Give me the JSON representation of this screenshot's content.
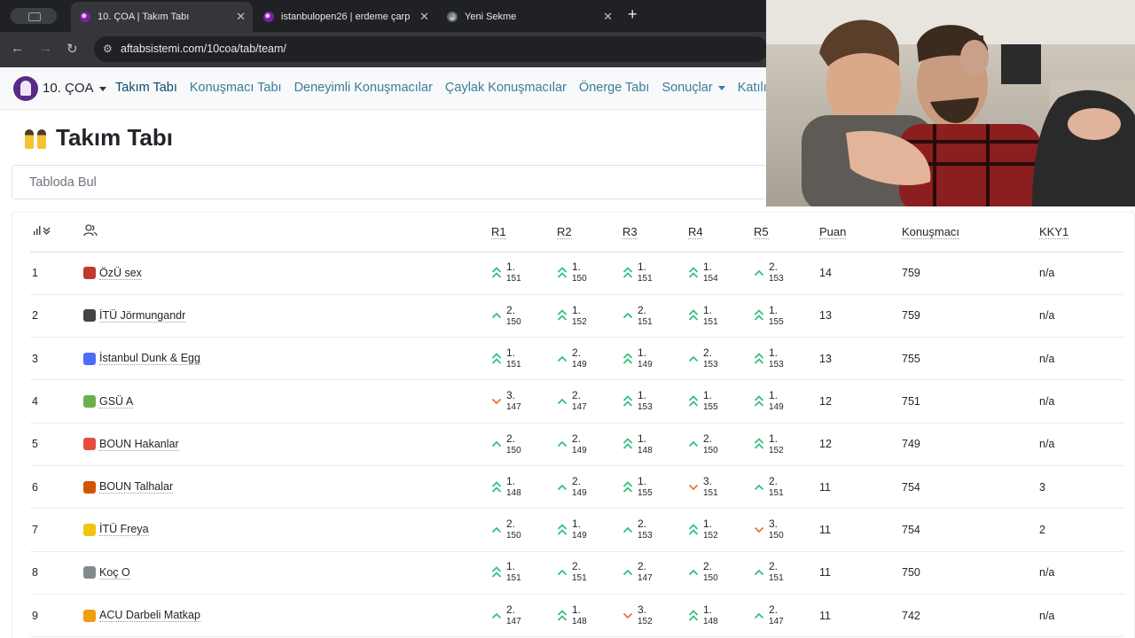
{
  "browser": {
    "tabs": [
      {
        "title": "10. ÇOA | Takım Tabı",
        "favicon": "purple-logo-icon"
      },
      {
        "title": "istanbulopen26 | erdeme çarp",
        "favicon": "purple-logo-icon"
      },
      {
        "title": "Yeni Sekme",
        "favicon": "chrome-icon"
      }
    ],
    "url": "aftabsistemi.com/10coa/tab/team/"
  },
  "navbar": {
    "brand": "10. ÇOA",
    "links": [
      "Takım Tabı",
      "Konuşmacı Tabı",
      "Deneyimli Konuşmacılar",
      "Çaylak Konuşmacılar",
      "Önerge Tabı",
      "Sonuçlar",
      "Katılı"
    ]
  },
  "page": {
    "title": "Takım Tabı",
    "search_placeholder": "Tabloda Bul"
  },
  "table": {
    "headers": [
      "R1",
      "R2",
      "R3",
      "R4",
      "R5",
      "Puan",
      "Konuşmacı",
      "KKY1"
    ],
    "rows": [
      {
        "rank": "1",
        "emoji_color": "#c0392b",
        "team": "ÖzÜ sex",
        "rounds": [
          [
            "1.",
            "151",
            "up2"
          ],
          [
            "1.",
            "150",
            "up2"
          ],
          [
            "1.",
            "151",
            "up2"
          ],
          [
            "1.",
            "154",
            "up2"
          ],
          [
            "2.",
            "153",
            "up1"
          ]
        ],
        "points": "14",
        "speaker": "759",
        "kky1": "n/a"
      },
      {
        "rank": "2",
        "emoji_color": "#444444",
        "team": "İTÜ Jörmungandr",
        "rounds": [
          [
            "2.",
            "150",
            "up1"
          ],
          [
            "1.",
            "152",
            "up2"
          ],
          [
            "2.",
            "151",
            "up1"
          ],
          [
            "1.",
            "151",
            "up2"
          ],
          [
            "1.",
            "155",
            "up2"
          ]
        ],
        "points": "13",
        "speaker": "759",
        "kky1": "n/a"
      },
      {
        "rank": "3",
        "emoji_color": "#4a6cf7",
        "team": "İstanbul Dunk & Egg",
        "rounds": [
          [
            "1.",
            "151",
            "up2"
          ],
          [
            "2.",
            "149",
            "up1"
          ],
          [
            "1.",
            "149",
            "up2"
          ],
          [
            "2.",
            "153",
            "up1"
          ],
          [
            "1.",
            "153",
            "up2"
          ]
        ],
        "points": "13",
        "speaker": "755",
        "kky1": "n/a"
      },
      {
        "rank": "4",
        "emoji_color": "#6ab04c",
        "team": "GSÜ A",
        "rounds": [
          [
            "3.",
            "147",
            "down"
          ],
          [
            "2.",
            "147",
            "up1"
          ],
          [
            "1.",
            "153",
            "up2"
          ],
          [
            "1.",
            "155",
            "up2"
          ],
          [
            "1.",
            "149",
            "up2"
          ]
        ],
        "points": "12",
        "speaker": "751",
        "kky1": "n/a"
      },
      {
        "rank": "5",
        "emoji_color": "#e74c3c",
        "team": "BOUN Hakanlar",
        "rounds": [
          [
            "2.",
            "150",
            "up1"
          ],
          [
            "2.",
            "149",
            "up1"
          ],
          [
            "1.",
            "148",
            "up2"
          ],
          [
            "2.",
            "150",
            "up1"
          ],
          [
            "1.",
            "152",
            "up2"
          ]
        ],
        "points": "12",
        "speaker": "749",
        "kky1": "n/a"
      },
      {
        "rank": "6",
        "emoji_color": "#d35400",
        "team": "BOUN Talhalar",
        "rounds": [
          [
            "1.",
            "148",
            "up2"
          ],
          [
            "2.",
            "149",
            "up1"
          ],
          [
            "1.",
            "155",
            "up2"
          ],
          [
            "3.",
            "151",
            "down"
          ],
          [
            "2.",
            "151",
            "up1"
          ]
        ],
        "points": "11",
        "speaker": "754",
        "kky1": "3"
      },
      {
        "rank": "7",
        "emoji_color": "#f1c40f",
        "team": "İTÜ Freya",
        "rounds": [
          [
            "2.",
            "150",
            "up1"
          ],
          [
            "1.",
            "149",
            "up2"
          ],
          [
            "2.",
            "153",
            "up1"
          ],
          [
            "1.",
            "152",
            "up2"
          ],
          [
            "3.",
            "150",
            "down"
          ]
        ],
        "points": "11",
        "speaker": "754",
        "kky1": "2"
      },
      {
        "rank": "8",
        "emoji_color": "#7f8c8d",
        "team": "Koç O",
        "rounds": [
          [
            "1.",
            "151",
            "up2"
          ],
          [
            "2.",
            "151",
            "up1"
          ],
          [
            "2.",
            "147",
            "up1"
          ],
          [
            "2.",
            "150",
            "up1"
          ],
          [
            "2.",
            "151",
            "up1"
          ]
        ],
        "points": "11",
        "speaker": "750",
        "kky1": "n/a"
      },
      {
        "rank": "9",
        "emoji_color": "#f39c12",
        "team": "ACU Darbeli Matkap",
        "rounds": [
          [
            "2.",
            "147",
            "up1"
          ],
          [
            "1.",
            "148",
            "up2"
          ],
          [
            "3.",
            "152",
            "down"
          ],
          [
            "1.",
            "148",
            "up2"
          ],
          [
            "2.",
            "147",
            "up1"
          ]
        ],
        "points": "11",
        "speaker": "742",
        "kky1": "n/a"
      }
    ]
  },
  "colors": {
    "up": "#2ec27e",
    "down": "#e8743b",
    "link": "#3a7c9a"
  }
}
